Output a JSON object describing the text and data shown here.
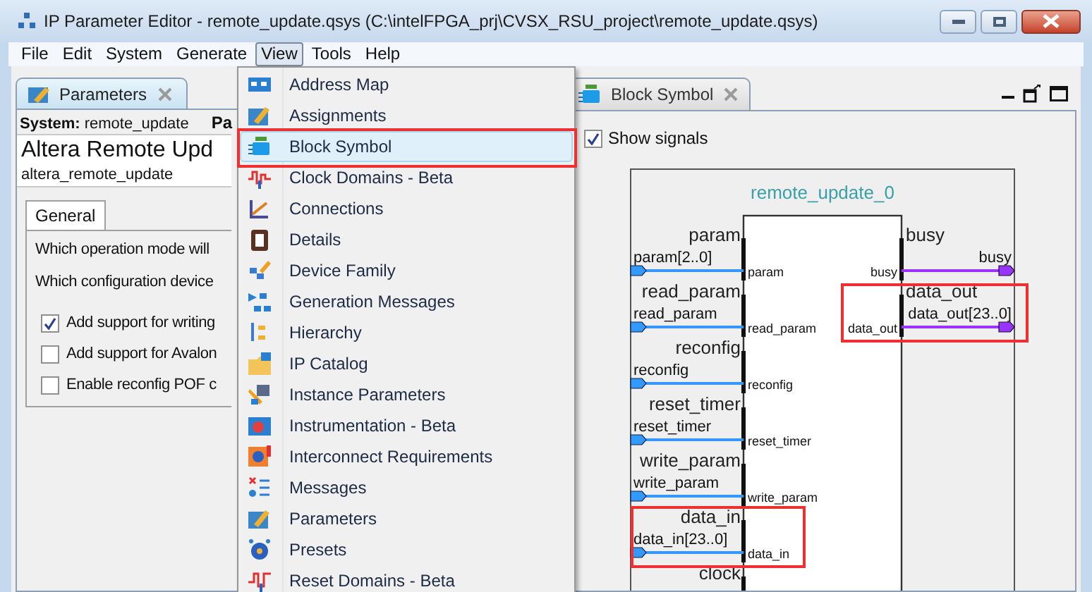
{
  "window": {
    "title": "IP Parameter Editor - remote_update.qsys (C:\\intelFPGA_prj\\CVSX_RSU_project\\remote_update.qsys)"
  },
  "menu_bar": [
    {
      "label": "File",
      "selected": false
    },
    {
      "label": "Edit",
      "selected": false
    },
    {
      "label": "System",
      "selected": false
    },
    {
      "label": "Generate",
      "selected": false
    },
    {
      "label": "View",
      "selected": true
    },
    {
      "label": "Tools",
      "selected": false
    },
    {
      "label": "Help",
      "selected": false
    }
  ],
  "view_menu": [
    {
      "label": "Address Map",
      "selected": false
    },
    {
      "label": "Assignments",
      "selected": false
    },
    {
      "label": "Block Symbol",
      "selected": true
    },
    {
      "label": "Clock Domains - Beta",
      "selected": false
    },
    {
      "label": "Connections",
      "selected": false
    },
    {
      "label": "Details",
      "selected": false
    },
    {
      "label": "Device Family",
      "selected": false
    },
    {
      "label": "Generation Messages",
      "selected": false
    },
    {
      "label": "Hierarchy",
      "selected": false
    },
    {
      "label": "IP Catalog",
      "selected": false
    },
    {
      "label": "Instance Parameters",
      "selected": false
    },
    {
      "label": "Instrumentation - Beta",
      "selected": false
    },
    {
      "label": "Interconnect Requirements",
      "selected": false
    },
    {
      "label": "Messages",
      "selected": false
    },
    {
      "label": "Parameters",
      "selected": false
    },
    {
      "label": "Presets",
      "selected": false
    },
    {
      "label": "Reset Domains - Beta",
      "selected": false
    }
  ],
  "parameters_panel": {
    "tab": "Parameters",
    "system": "**System:** remote_update",
    "system_right": "Pa",
    "component_title": "Altera Remote Upd",
    "component_name": "altera_remote_update",
    "sub_tabs": [
      {
        "label": "General",
        "selected": true
      }
    ],
    "questions": [
      "Which operation mode will",
      "Which configuration device"
    ],
    "options": [
      {
        "label": "Add support for writing",
        "checked": true
      },
      {
        "label": "Add support for Avalon",
        "checked": false
      },
      {
        "label": "Enable reconfig POF c",
        "checked": false
      }
    ]
  },
  "block_symbol_panel": {
    "tab": "Block Symbol",
    "show_signals": {
      "label": "Show signals",
      "checked": true
    },
    "component": "remote_update_0",
    "left_ports": [
      {
        "name": "param",
        "signal": "param[2..0]",
        "pin": "param",
        "color": "#3399ff"
      },
      {
        "name": "read_param",
        "signal": "read_param",
        "pin": "read_param",
        "color": "#3399ff"
      },
      {
        "name": "reconfig",
        "signal": "reconfig",
        "pin": "reconfig",
        "color": "#3399ff"
      },
      {
        "name": "reset_timer",
        "signal": "reset_timer",
        "pin": "reset_timer",
        "color": "#3399ff"
      },
      {
        "name": "write_param",
        "signal": "write_param",
        "pin": "write_param",
        "color": "#3399ff"
      },
      {
        "name": "data_in",
        "signal": "data_in[23..0]",
        "pin": "data_in",
        "color": "#3399ff"
      },
      {
        "name": "clock"
      }
    ],
    "right_ports": [
      {
        "name": "busy",
        "signal": "busy",
        "pin": "busy",
        "color": "#9933ff"
      },
      {
        "name": "data_out",
        "signal": "data_out[23..0]",
        "pin": "data_out",
        "color": "#9933ff"
      }
    ]
  }
}
